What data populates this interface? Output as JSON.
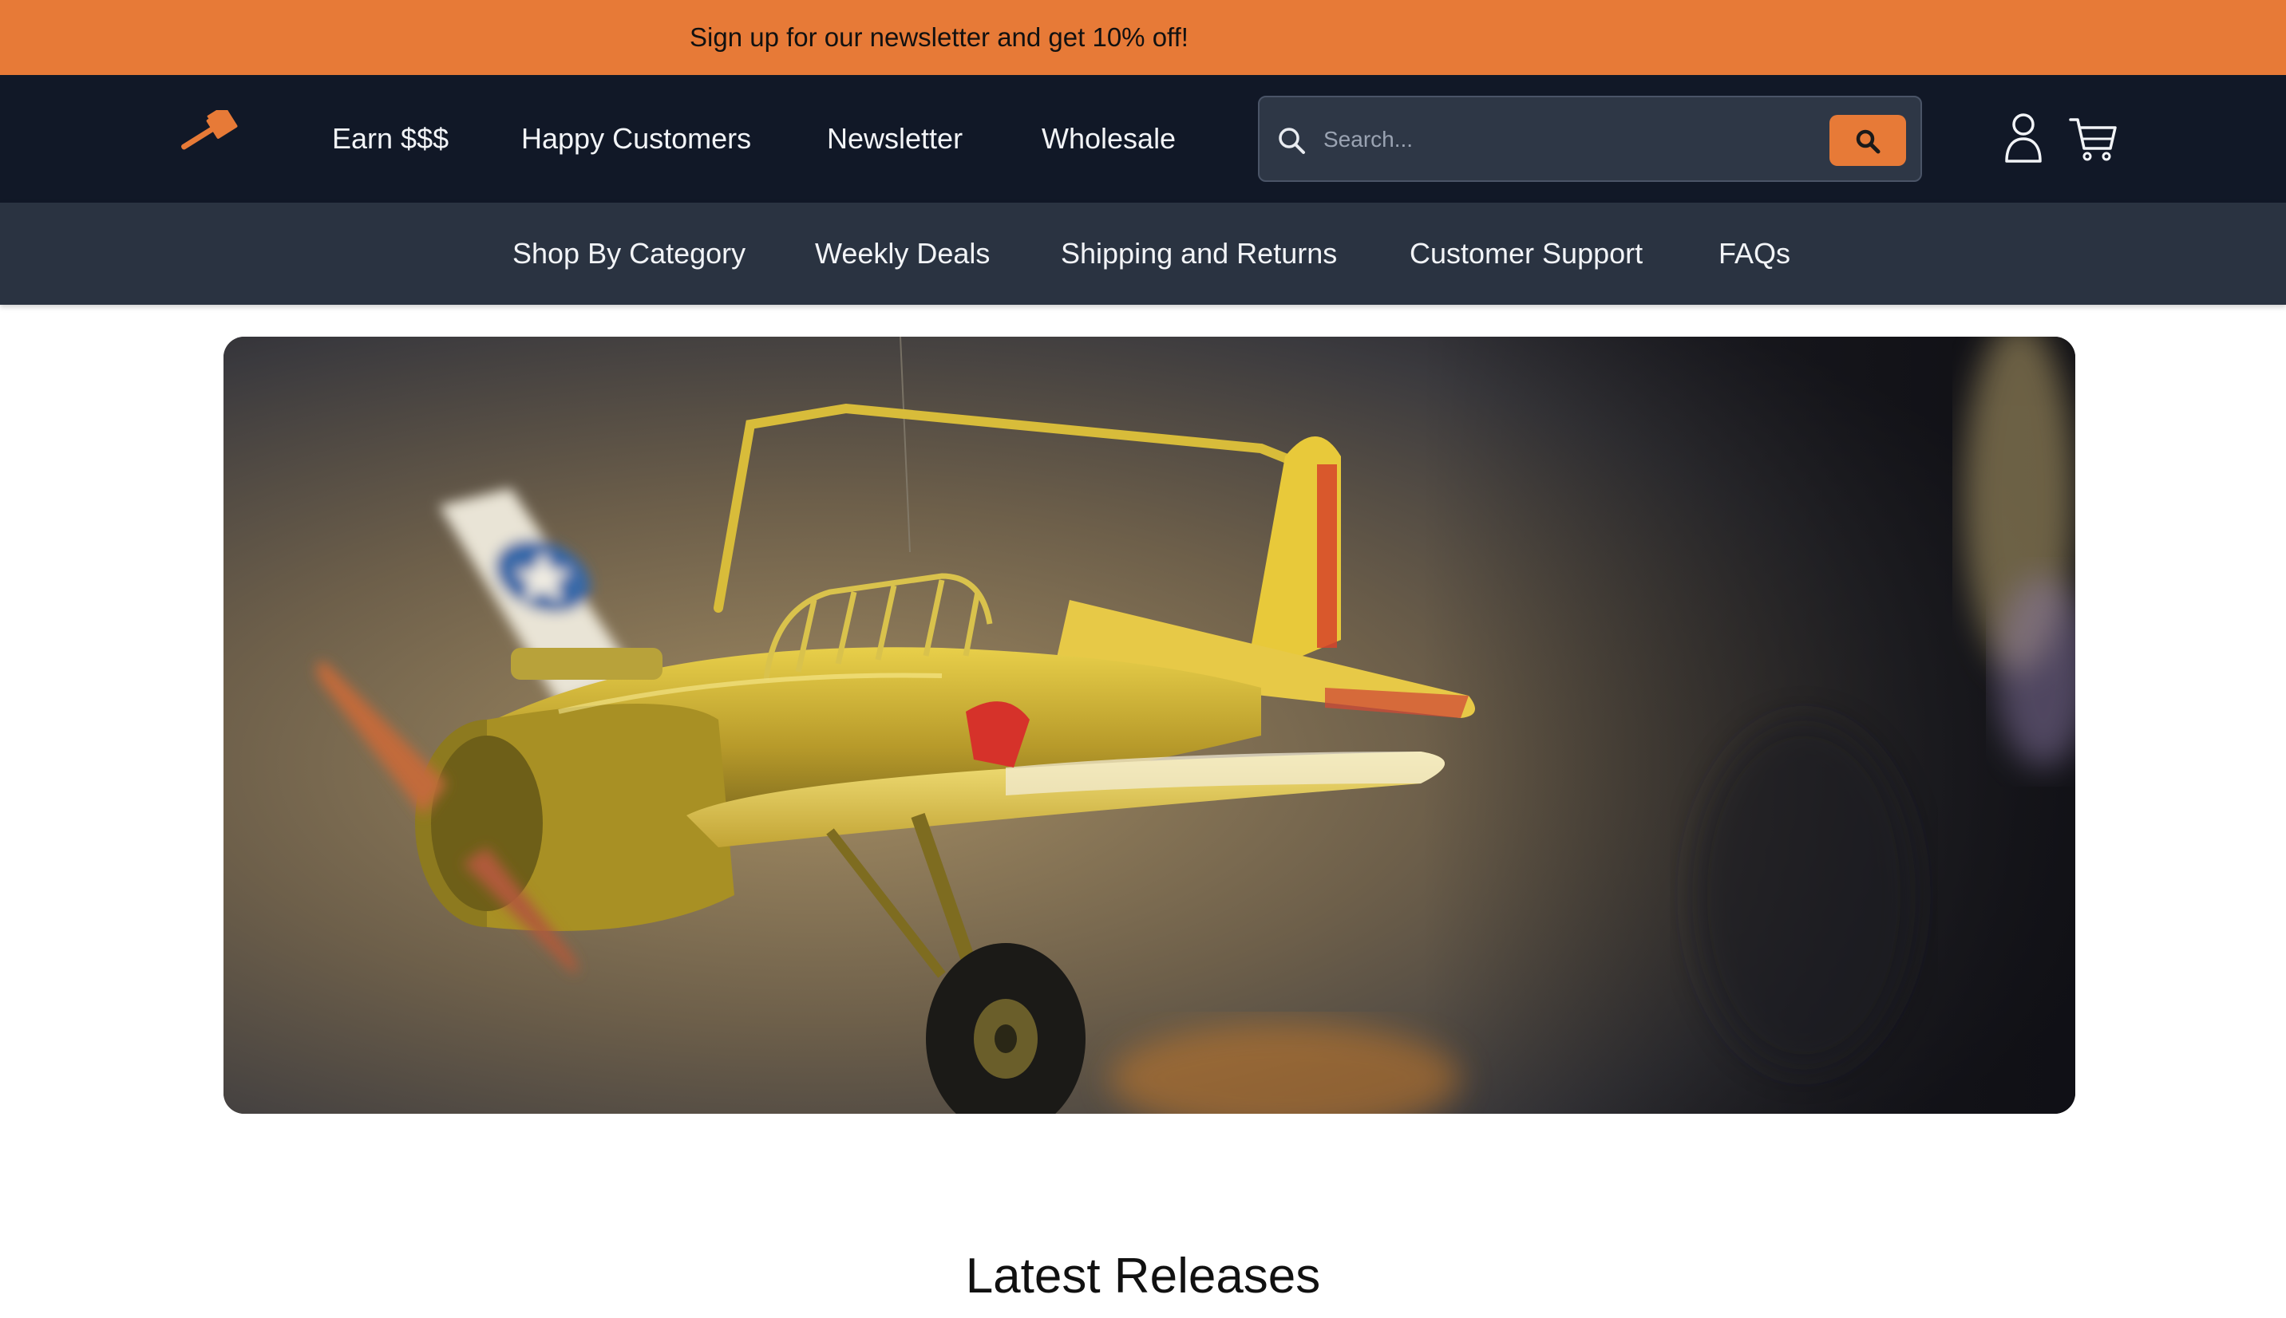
{
  "announcement": {
    "text": "Sign up for our newsletter and get 10% off!"
  },
  "header": {
    "logo_icon": "hammer-logo-icon",
    "nav": [
      {
        "label": "Earn $$$"
      },
      {
        "label": "Happy Customers"
      },
      {
        "label": "Newsletter"
      },
      {
        "label": "Wholesale"
      }
    ],
    "search": {
      "placeholder": "Search...",
      "value": "",
      "icon": "search-icon",
      "button_icon": "search-icon"
    },
    "account_icon": "user-icon",
    "cart_icon": "cart-icon"
  },
  "subnav": {
    "items": [
      {
        "label": "Shop By Category"
      },
      {
        "label": "Weekly Deals"
      },
      {
        "label": "Shipping and Returns"
      },
      {
        "label": "Customer Support"
      },
      {
        "label": "FAQs"
      }
    ]
  },
  "hero": {
    "image": "yellow-toy-biplane-photo"
  },
  "sections": {
    "latest_title": "Latest Releases"
  },
  "colors": {
    "accent": "#E77A37",
    "header_bg": "#111827",
    "subnav_bg": "#2a3341"
  }
}
